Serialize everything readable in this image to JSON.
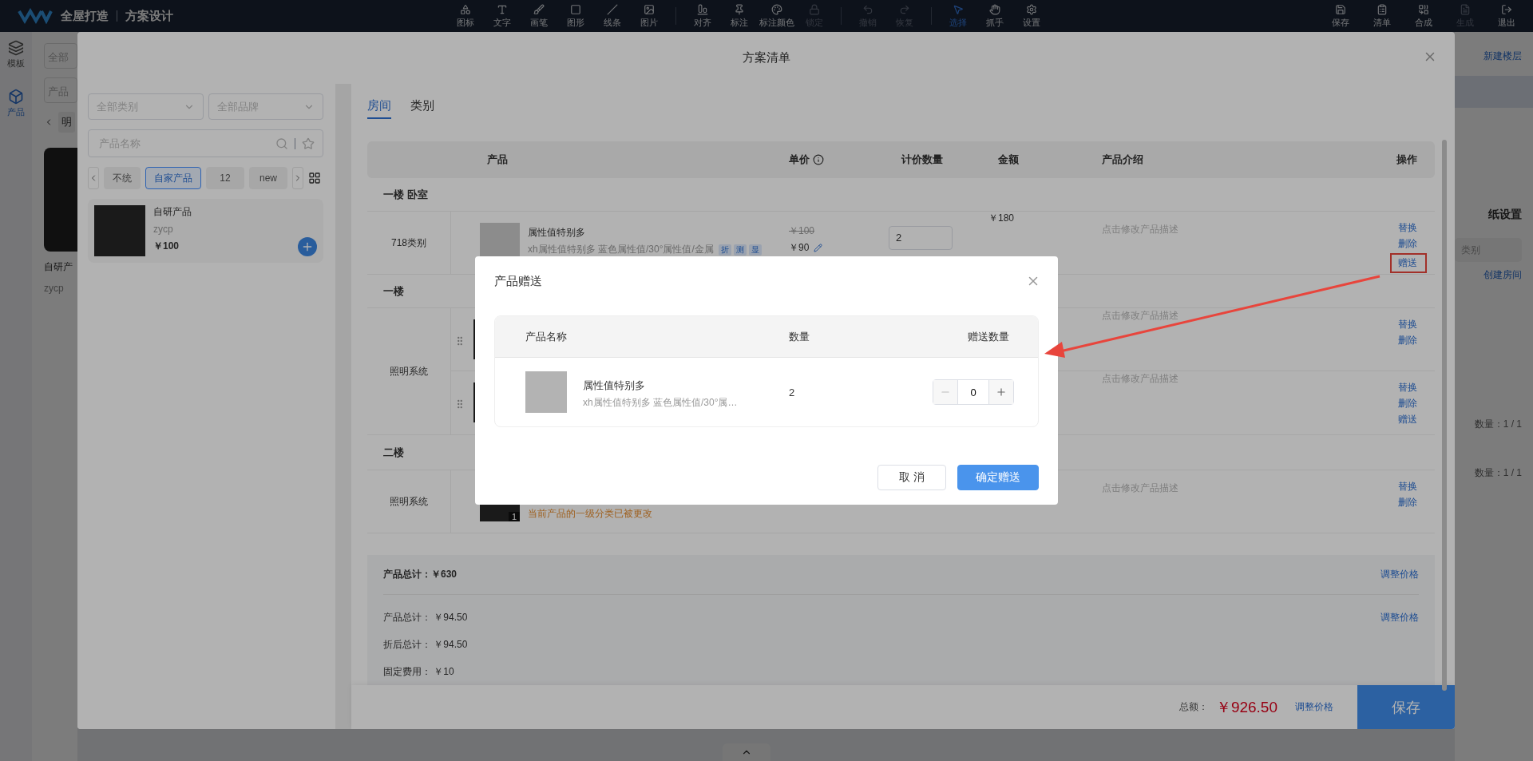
{
  "topbar": {
    "brand": "全屋打造",
    "module": "方案设计",
    "tool_groups": [
      [
        {
          "label": "图标",
          "selected": false,
          "disabled": false
        },
        {
          "label": "文字",
          "selected": false,
          "disabled": false
        },
        {
          "label": "画笔",
          "selected": false,
          "disabled": false
        },
        {
          "label": "图形",
          "selected": false,
          "disabled": false
        },
        {
          "label": "线条",
          "selected": false,
          "disabled": false
        },
        {
          "label": "图片",
          "selected": false,
          "disabled": false
        }
      ],
      [
        {
          "label": "对齐",
          "selected": false,
          "disabled": false
        },
        {
          "label": "标注",
          "selected": false,
          "disabled": false
        },
        {
          "label": "标注颜色",
          "selected": false,
          "disabled": false
        },
        {
          "label": "锁定",
          "selected": false,
          "disabled": true
        }
      ],
      [
        {
          "label": "撤销",
          "selected": false,
          "disabled": true
        },
        {
          "label": "恢复",
          "selected": false,
          "disabled": true
        }
      ],
      [
        {
          "label": "选择",
          "selected": true,
          "disabled": false
        },
        {
          "label": "抓手",
          "selected": false,
          "disabled": false
        },
        {
          "label": "设置",
          "selected": false,
          "disabled": false
        }
      ]
    ],
    "actions": [
      {
        "label": "保存",
        "disabled": false
      },
      {
        "label": "清单",
        "disabled": false
      },
      {
        "label": "合成",
        "disabled": false
      },
      {
        "label": "生成",
        "disabled": true
      },
      {
        "label": "退出",
        "disabled": false
      }
    ]
  },
  "side_tabs": [
    {
      "label": "模板",
      "selected": false
    },
    {
      "label": "产品",
      "selected": true
    }
  ],
  "bg_left": {
    "category_field": "全部",
    "search_field": "产品",
    "chip": "明",
    "card_name": "自研产",
    "card_code": "zycp"
  },
  "bg_right": {
    "new_floor": "新建楼层",
    "settings_title": "纸设置",
    "category_field": "类别",
    "create_room": "创建房间",
    "counts": [
      "数量：1 / 1",
      "数量：1 / 1"
    ]
  },
  "list_modal": {
    "title": "方案清单",
    "filters": {
      "category_placeholder": "全部类别",
      "brand_placeholder": "全部品牌",
      "search_placeholder": "产品名称"
    },
    "chips": [
      {
        "label": "不统",
        "selected": false
      },
      {
        "label": "自家产品",
        "selected": true
      },
      {
        "label": "12",
        "selected": false
      },
      {
        "label": "new",
        "selected": false
      }
    ],
    "product": {
      "name": "自研产品",
      "code": "zycp",
      "price": "￥100"
    },
    "tabs": [
      {
        "label": "房间",
        "selected": true
      },
      {
        "label": "类别",
        "selected": false
      }
    ],
    "columns": [
      "产品",
      "单价",
      "计价数量",
      "金额",
      "产品介绍",
      "操作"
    ],
    "groups": [
      {
        "title": "一楼 卧室",
        "rows": [
          {
            "category": "718类别",
            "items": [
              {
                "draggable": false,
                "name": "属性值特别多",
                "desc": "xh属性值特别多 蓝色属性值/30°属性值/金属",
                "tags": [
                  "折",
                  "测",
                  "显"
                ],
                "old_price": "￥100",
                "price": "￥90",
                "qty": "2",
                "amount": "￥180",
                "intro": "点击修改产品描述",
                "actions": [
                  {
                    "label": "替换",
                    "highlighted": false
                  },
                  {
                    "label": "删除",
                    "highlighted": false
                  },
                  {
                    "label": "赠送",
                    "highlighted": true
                  }
                ]
              }
            ]
          }
        ]
      },
      {
        "title": "一楼",
        "rows": [
          {
            "category": "照明系统",
            "items": [
              {
                "draggable": true,
                "intro": "点击修改产品描述",
                "actions": [
                  {
                    "label": "替换",
                    "highlighted": false
                  },
                  {
                    "label": "删除",
                    "highlighted": false
                  }
                ]
              },
              {
                "draggable": true,
                "intro": "点击修改产品描述",
                "actions": [
                  {
                    "label": "替换",
                    "highlighted": false
                  },
                  {
                    "label": "删除",
                    "highlighted": false
                  },
                  {
                    "label": "赠送",
                    "highlighted": false
                  }
                ]
              }
            ]
          }
        ]
      },
      {
        "title": "二楼",
        "rows": [
          {
            "category": "照明系统",
            "items": [
              {
                "draggable": false,
                "badge": "1",
                "warning": "当前产品的一级分类已被更改",
                "intro": "点击修改产品描述",
                "actions": [
                  {
                    "label": "替换",
                    "highlighted": false
                  },
                  {
                    "label": "删除",
                    "highlighted": false
                  }
                ]
              }
            ]
          }
        ]
      }
    ],
    "summary": {
      "main": {
        "label": "产品总计：",
        "value": "￥630",
        "action": "调整价格"
      },
      "lines": [
        {
          "label": "产品总计：",
          "value": "￥94.50",
          "action": "调整价格"
        },
        {
          "label": "折后总计：",
          "value": "￥94.50"
        },
        {
          "label": "固定费用：",
          "value": "￥10"
        }
      ]
    },
    "footer": {
      "total_label": "总额：",
      "total": "￥926.50",
      "adjust": "调整价格",
      "save": "保存"
    }
  },
  "gift_dialog": {
    "title": "产品赠送",
    "columns": [
      "产品名称",
      "数量",
      "赠送数量"
    ],
    "rows": [
      {
        "name": "属性值特别多",
        "desc": "xh属性值特别多 蓝色属性值/30°属…",
        "qty": "2",
        "gift_qty": "0"
      }
    ],
    "cancel": "取 消",
    "confirm": "确定赠送"
  }
}
